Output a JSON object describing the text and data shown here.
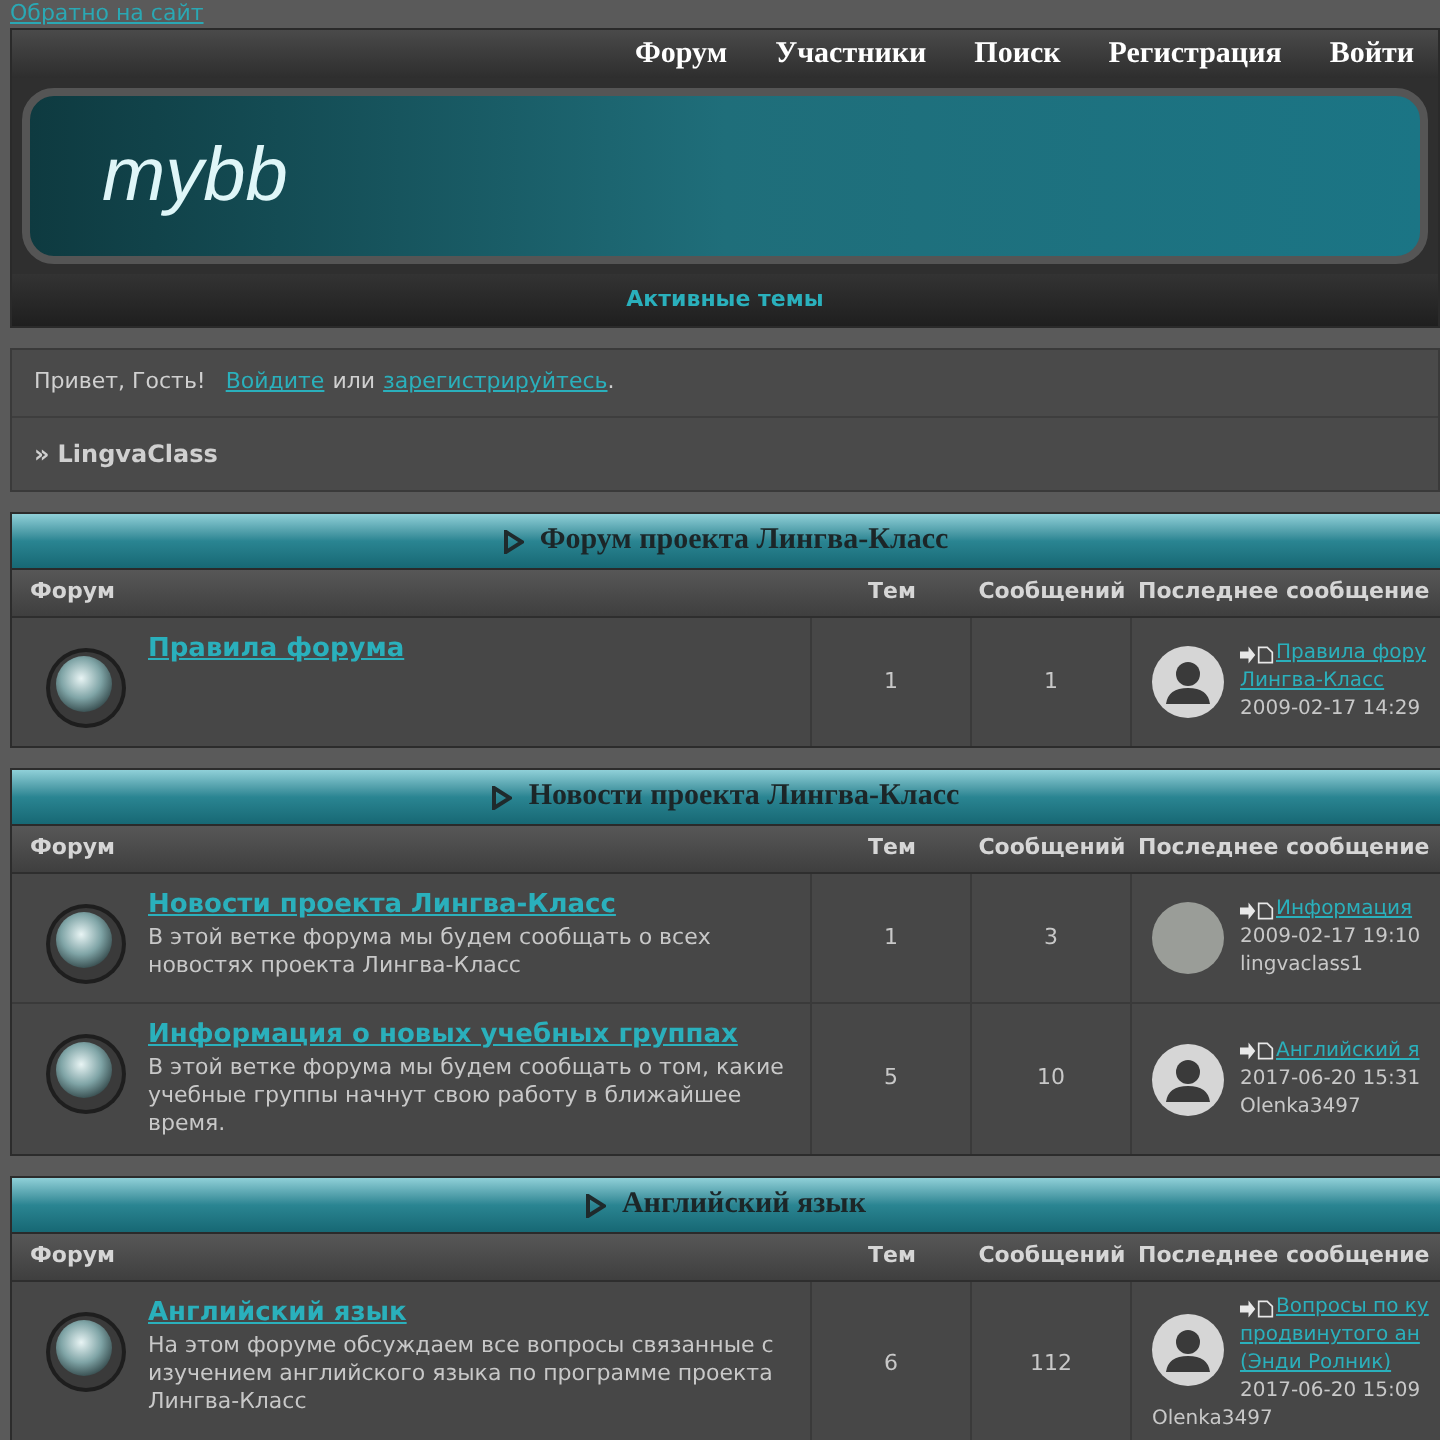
{
  "back_link": "Обратно на сайт",
  "nav": [
    "Форум",
    "Участники",
    "Поиск",
    "Регистрация",
    "Войти"
  ],
  "logo": "mybb",
  "active_topics": "Активные темы",
  "welcome": {
    "greeting": "Привет, Гость!",
    "login": "Войдите",
    "or": "или",
    "register": "зарегистрируйтесь",
    "end": "."
  },
  "breadcrumb": {
    "sep": "»",
    "label": "LingvaClass"
  },
  "categories": [
    {
      "title": "Форум проекта Лингва-Класс",
      "columns": [
        "Форум",
        "Тем",
        "Сообщений",
        "Последнее сообщение"
      ],
      "forums": [
        {
          "name": "Правила форума",
          "topics": "1",
          "posts": "1",
          "last": {
            "photo_avatar": false,
            "topic_lines": [
              "Правила фору",
              "Лингва-Класс"
            ],
            "date": "2009-02-17 14:29"
          }
        }
      ]
    },
    {
      "title": "Новости проекта Лингва-Класс",
      "columns": [
        "Форум",
        "Тем",
        "Сообщений",
        "Последнее сообщение"
      ],
      "forums": [
        {
          "name": "Новости проекта Лингва-Класс",
          "description": "В этой ветке форума мы будем сообщать о всех новостях проекта Лингва-Класс",
          "topics": "1",
          "posts": "3",
          "last": {
            "photo_avatar": true,
            "topic_lines": [
              "Информация"
            ],
            "date": "2009-02-17 19:10",
            "author": "lingvaclass1"
          }
        },
        {
          "name": "Информация о новых учебных группах",
          "description": "В этой ветке форума мы будем сообщать о том, какие учебные группы начнут свою работу в ближайшее время.",
          "topics": "5",
          "posts": "10",
          "last": {
            "photo_avatar": false,
            "topic_lines": [
              "Английский я"
            ],
            "date": "2017-06-20 15:31",
            "author": "Olenka3497"
          }
        }
      ]
    },
    {
      "title": "Английский язык",
      "columns": [
        "Форум",
        "Тем",
        "Сообщений",
        "Последнее сообщение"
      ],
      "forums": [
        {
          "name": "Английский язык",
          "description": "На этом форуме обсуждаем все вопросы связанные с изучением английского языка по программе проекта Лингва-Класс",
          "topics": "6",
          "posts": "112",
          "last": {
            "photo_avatar": false,
            "topic_lines": [
              "Вопросы по ку",
              "продвинутого ан",
              "(Энди Ролник)"
            ],
            "date": "2017-06-20 15:09",
            "author": "Olenka3497"
          }
        }
      ]
    }
  ]
}
